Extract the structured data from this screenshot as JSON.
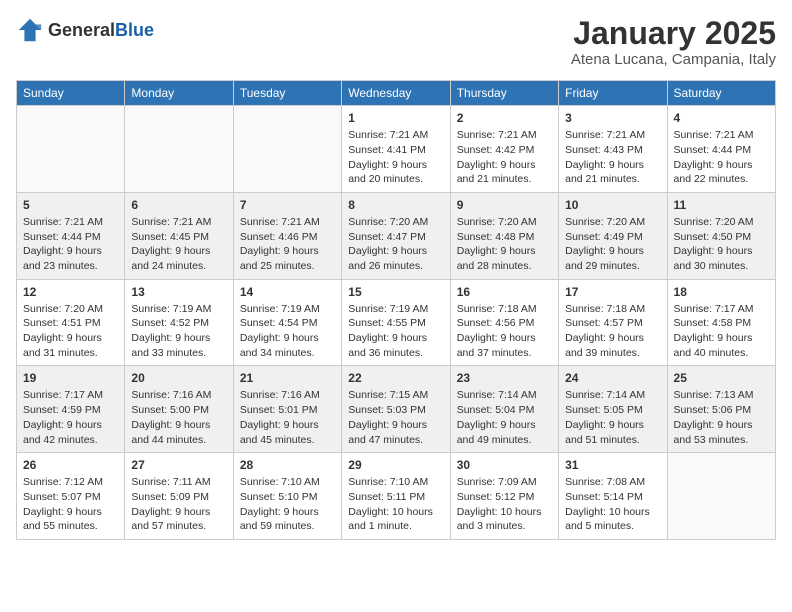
{
  "logo": {
    "general": "General",
    "blue": "Blue"
  },
  "title": "January 2025",
  "location": "Atena Lucana, Campania, Italy",
  "weekdays": [
    "Sunday",
    "Monday",
    "Tuesday",
    "Wednesday",
    "Thursday",
    "Friday",
    "Saturday"
  ],
  "weeks": [
    [
      {
        "day": "",
        "info": ""
      },
      {
        "day": "",
        "info": ""
      },
      {
        "day": "",
        "info": ""
      },
      {
        "day": "1",
        "info": "Sunrise: 7:21 AM\nSunset: 4:41 PM\nDaylight: 9 hours\nand 20 minutes."
      },
      {
        "day": "2",
        "info": "Sunrise: 7:21 AM\nSunset: 4:42 PM\nDaylight: 9 hours\nand 21 minutes."
      },
      {
        "day": "3",
        "info": "Sunrise: 7:21 AM\nSunset: 4:43 PM\nDaylight: 9 hours\nand 21 minutes."
      },
      {
        "day": "4",
        "info": "Sunrise: 7:21 AM\nSunset: 4:44 PM\nDaylight: 9 hours\nand 22 minutes."
      }
    ],
    [
      {
        "day": "5",
        "info": "Sunrise: 7:21 AM\nSunset: 4:44 PM\nDaylight: 9 hours\nand 23 minutes."
      },
      {
        "day": "6",
        "info": "Sunrise: 7:21 AM\nSunset: 4:45 PM\nDaylight: 9 hours\nand 24 minutes."
      },
      {
        "day": "7",
        "info": "Sunrise: 7:21 AM\nSunset: 4:46 PM\nDaylight: 9 hours\nand 25 minutes."
      },
      {
        "day": "8",
        "info": "Sunrise: 7:20 AM\nSunset: 4:47 PM\nDaylight: 9 hours\nand 26 minutes."
      },
      {
        "day": "9",
        "info": "Sunrise: 7:20 AM\nSunset: 4:48 PM\nDaylight: 9 hours\nand 28 minutes."
      },
      {
        "day": "10",
        "info": "Sunrise: 7:20 AM\nSunset: 4:49 PM\nDaylight: 9 hours\nand 29 minutes."
      },
      {
        "day": "11",
        "info": "Sunrise: 7:20 AM\nSunset: 4:50 PM\nDaylight: 9 hours\nand 30 minutes."
      }
    ],
    [
      {
        "day": "12",
        "info": "Sunrise: 7:20 AM\nSunset: 4:51 PM\nDaylight: 9 hours\nand 31 minutes."
      },
      {
        "day": "13",
        "info": "Sunrise: 7:19 AM\nSunset: 4:52 PM\nDaylight: 9 hours\nand 33 minutes."
      },
      {
        "day": "14",
        "info": "Sunrise: 7:19 AM\nSunset: 4:54 PM\nDaylight: 9 hours\nand 34 minutes."
      },
      {
        "day": "15",
        "info": "Sunrise: 7:19 AM\nSunset: 4:55 PM\nDaylight: 9 hours\nand 36 minutes."
      },
      {
        "day": "16",
        "info": "Sunrise: 7:18 AM\nSunset: 4:56 PM\nDaylight: 9 hours\nand 37 minutes."
      },
      {
        "day": "17",
        "info": "Sunrise: 7:18 AM\nSunset: 4:57 PM\nDaylight: 9 hours\nand 39 minutes."
      },
      {
        "day": "18",
        "info": "Sunrise: 7:17 AM\nSunset: 4:58 PM\nDaylight: 9 hours\nand 40 minutes."
      }
    ],
    [
      {
        "day": "19",
        "info": "Sunrise: 7:17 AM\nSunset: 4:59 PM\nDaylight: 9 hours\nand 42 minutes."
      },
      {
        "day": "20",
        "info": "Sunrise: 7:16 AM\nSunset: 5:00 PM\nDaylight: 9 hours\nand 44 minutes."
      },
      {
        "day": "21",
        "info": "Sunrise: 7:16 AM\nSunset: 5:01 PM\nDaylight: 9 hours\nand 45 minutes."
      },
      {
        "day": "22",
        "info": "Sunrise: 7:15 AM\nSunset: 5:03 PM\nDaylight: 9 hours\nand 47 minutes."
      },
      {
        "day": "23",
        "info": "Sunrise: 7:14 AM\nSunset: 5:04 PM\nDaylight: 9 hours\nand 49 minutes."
      },
      {
        "day": "24",
        "info": "Sunrise: 7:14 AM\nSunset: 5:05 PM\nDaylight: 9 hours\nand 51 minutes."
      },
      {
        "day": "25",
        "info": "Sunrise: 7:13 AM\nSunset: 5:06 PM\nDaylight: 9 hours\nand 53 minutes."
      }
    ],
    [
      {
        "day": "26",
        "info": "Sunrise: 7:12 AM\nSunset: 5:07 PM\nDaylight: 9 hours\nand 55 minutes."
      },
      {
        "day": "27",
        "info": "Sunrise: 7:11 AM\nSunset: 5:09 PM\nDaylight: 9 hours\nand 57 minutes."
      },
      {
        "day": "28",
        "info": "Sunrise: 7:10 AM\nSunset: 5:10 PM\nDaylight: 9 hours\nand 59 minutes."
      },
      {
        "day": "29",
        "info": "Sunrise: 7:10 AM\nSunset: 5:11 PM\nDaylight: 10 hours\nand 1 minute."
      },
      {
        "day": "30",
        "info": "Sunrise: 7:09 AM\nSunset: 5:12 PM\nDaylight: 10 hours\nand 3 minutes."
      },
      {
        "day": "31",
        "info": "Sunrise: 7:08 AM\nSunset: 5:14 PM\nDaylight: 10 hours\nand 5 minutes."
      },
      {
        "day": "",
        "info": ""
      }
    ]
  ]
}
